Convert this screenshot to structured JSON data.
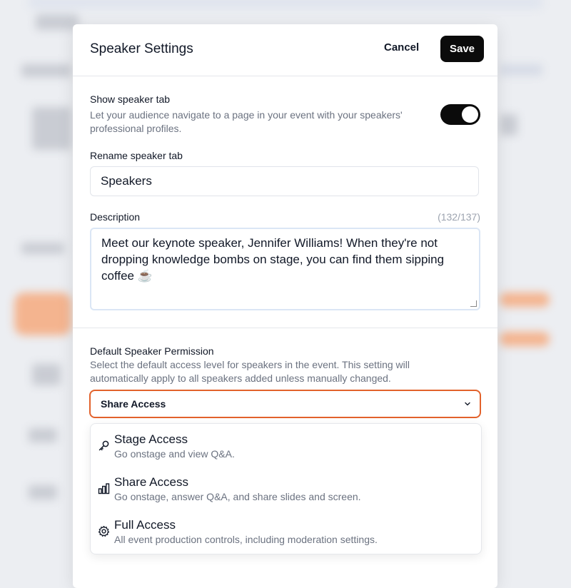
{
  "modal": {
    "title": "Speaker Settings",
    "cancel_label": "Cancel",
    "save_label": "Save"
  },
  "show_tab": {
    "label": "Show speaker tab",
    "helper": "Let your audience navigate to a page in your event with your speakers' professional profiles.",
    "enabled": true
  },
  "rename": {
    "label": "Rename speaker tab",
    "value": "Speakers"
  },
  "description": {
    "label": "Description",
    "counter": "(132/137)",
    "value": "Meet our keynote speaker, Jennifer Williams! When they're not dropping knowledge bombs on stage, you can find them sipping coffee ☕"
  },
  "permission": {
    "label": "Default Speaker Permission",
    "helper": "Select the default access level for speakers in the event. This setting will automatically apply to all speakers added unless manually changed.",
    "selected": "Share Access",
    "options": [
      {
        "title": "Stage Access",
        "desc": "Go onstage and view Q&A.",
        "icon": "key-icon"
      },
      {
        "title": "Share Access",
        "desc": "Go onstage, answer Q&A, and share slides and screen.",
        "icon": "bar-chart-icon"
      },
      {
        "title": "Full Access",
        "desc": "All event production controls, including moderation settings.",
        "icon": "gear-icon"
      }
    ]
  },
  "colors": {
    "accent": "#e2622b",
    "primary_button": "#0b0b0b"
  }
}
